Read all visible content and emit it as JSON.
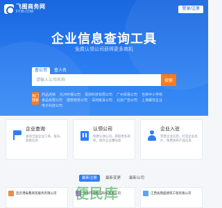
{
  "header": {
    "logo_name": "飞图商务网",
    "logo_domain": "FY36.COM",
    "login_label": "登录/注册"
  },
  "hero": {
    "title": "企业信息查询工具",
    "subtitle": "免费认领公司获得更多商机"
  },
  "search": {
    "tabs": [
      "查公司",
      "查人名"
    ],
    "active_tab": 0,
    "placeholder": "请输入公司名称",
    "button_label": "搜索"
  },
  "hot": {
    "label": "热门搜索",
    "links": [
      "药品连锁",
      "先河环保公司",
      "深圳科技有限公司",
      "广州贸易公司",
      "吉林中小学校",
      "食品有限公司",
      "建筑劳务公司",
      "深圳家具公司",
      "北京广告公司",
      "上海餐饮企业",
      "电子科技公司"
    ]
  },
  "features": [
    {
      "title": "企业查询",
      "desc": "查询全国企业工商、股东、高管信息",
      "icon": "flag-icon"
    },
    {
      "title": "认领公司",
      "desc": "免费认领公司，获取更多商机，提升企业曝光度",
      "icon": "building-icon"
    },
    {
      "title": "企业入驻",
      "desc": "完善企业信息，打造企业名片，免费发布产品信息",
      "icon": "person-icon"
    }
  ],
  "section": {
    "tabs": [
      "最新注册",
      "最新变更",
      "最新公司"
    ],
    "active_tab": 0
  },
  "companies": [
    {
      "name": "连云港泰鑫商贸服务有限公司",
      "color": "#f08a4b"
    },
    {
      "name": "深圳市德胜华科技有限公司",
      "color": "#b887e0"
    },
    {
      "name": "江西省鼎盛建筑工程有限公司",
      "color": "#5aa6f0"
    }
  ],
  "watermark": "便民库"
}
